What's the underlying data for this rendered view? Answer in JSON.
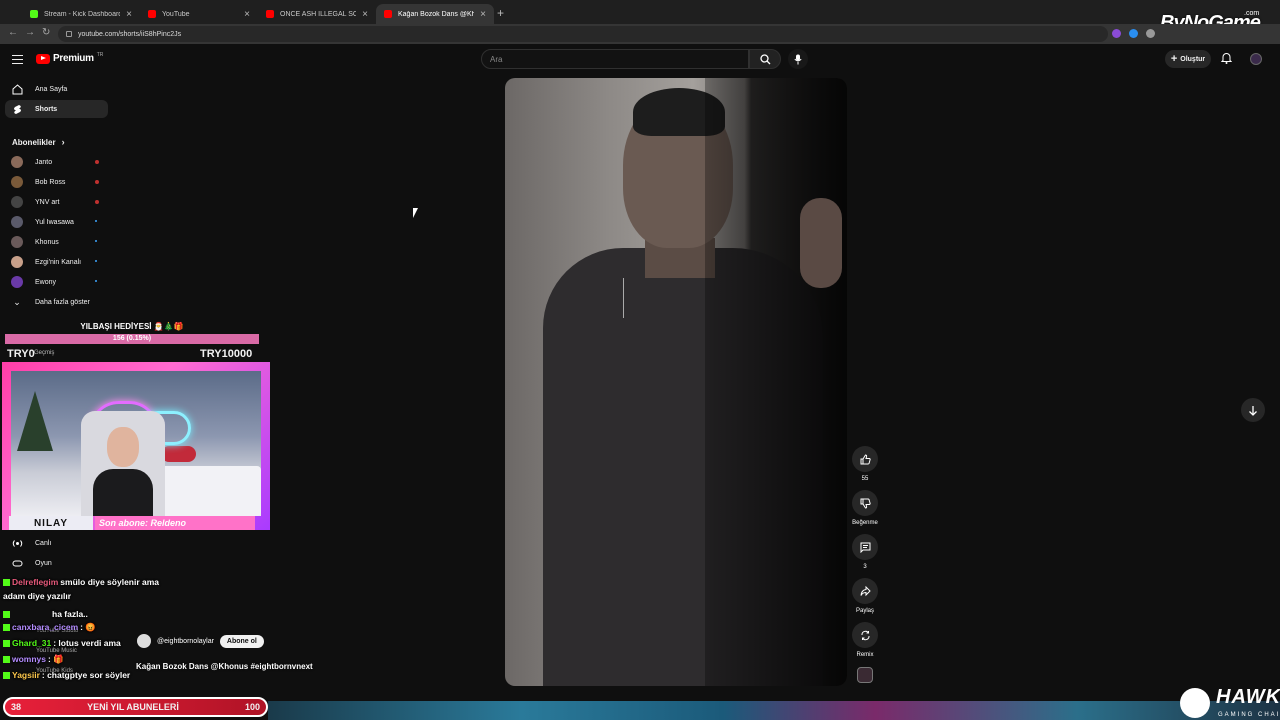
{
  "browser": {
    "tabs": [
      {
        "title": "Stream - Kick Dashboard",
        "active": false,
        "favicon_color": "#53fc18"
      },
      {
        "title": "YouTube",
        "active": false,
        "favicon_color": "#ff0000"
      },
      {
        "title": "ÖNCE ASH İLLEGAL SONRA M",
        "active": false,
        "favicon_color": "#ff0000"
      },
      {
        "title": "Kağan Bozok Dans @Khonu",
        "active": true,
        "favicon_color": "#ff0000"
      }
    ],
    "url": "youtube.com/shorts/iiS8hPinc2Js"
  },
  "overlay_brand": {
    "name": "ByNoGame",
    "suffix": ".com"
  },
  "youtube": {
    "logo": "Premium",
    "logo_region": "TR",
    "search_placeholder": "Ara",
    "create_label": "Oluştur"
  },
  "sidebar": {
    "top": [
      {
        "label": "Ana Sayfa",
        "icon": "home-icon",
        "active": false
      },
      {
        "label": "Shorts",
        "icon": "shorts-icon",
        "active": true
      }
    ],
    "subscriptions_header": "Abonelikler",
    "subscriptions": [
      {
        "name": "Janto",
        "live": true,
        "avatar_color": "#8a6a5a"
      },
      {
        "name": "Bob Ross",
        "live": true,
        "avatar_color": "#7a5a3a"
      },
      {
        "name": "YNV art",
        "live": true,
        "avatar_color": "#444"
      },
      {
        "name": "Yul Iwasawa",
        "live": false,
        "avatar_color": "#5a5a6a"
      },
      {
        "name": "Khonus",
        "live": false,
        "avatar_color": "#6a5a5a"
      },
      {
        "name": "Ezgi'nin Kanalı",
        "live": false,
        "avatar_color": "#c8a08a"
      },
      {
        "name": "Ewony",
        "live": false,
        "avatar_color": "#6a3aa8"
      }
    ],
    "show_more": "Daha fazla göster",
    "bottom": [
      {
        "label": "Canlı",
        "icon": "live-icon"
      },
      {
        "label": "Oyun",
        "icon": "gaming-icon"
      }
    ],
    "partial_labels": [
      "Geçmiş",
      "YouTube Studio",
      "YouTube Music",
      "YouTube Kids"
    ]
  },
  "stream_overlay": {
    "gift_title": "YILBAŞI HEDİYESİ 🎅🎄🎁",
    "gift_progress_text": "156 (0.15%)",
    "gift_progress_fraction": 0.0156,
    "goal_min": "TRY0",
    "goal_max": "TRY10000",
    "cam_name": "NILAY",
    "cam_last_sub": "Son abone: Reldeno",
    "goal_bar_left": "38",
    "goal_bar_title": "YENİ YIL ABUNELERİ",
    "goal_bar_right": "100",
    "sponsor": {
      "name": "HAWK",
      "sub": "GAMING CHAIR"
    }
  },
  "chat": [
    {
      "user": "Delreflegim",
      "text": "smülo diye söylenir ama"
    },
    {
      "user": "",
      "text": "adam diye yazılır"
    },
    {
      "user": "",
      "text": "ha fazla.."
    },
    {
      "user": "canxbara_cicem",
      "text": ": 😡"
    },
    {
      "user": "Ghard_31",
      "text": ": lotus verdi ama"
    },
    {
      "user": "womnys",
      "text": ": 🎁"
    },
    {
      "user": "Yagsiir",
      "text": ": chatgptye sor söyler"
    }
  ],
  "short": {
    "channel": "@eightbornolaylar",
    "subscribe_label": "Abone ol",
    "title": "Kağan Bozok Dans @Khonus #eightbornvnext",
    "actions": [
      {
        "label": "55",
        "icon": "like-icon"
      },
      {
        "label": "Beğenme",
        "icon": "dislike-icon"
      },
      {
        "label": "3",
        "icon": "comment-icon"
      },
      {
        "label": "Paylaş",
        "icon": "share-icon"
      },
      {
        "label": "Remix",
        "icon": "remix-icon"
      }
    ]
  }
}
